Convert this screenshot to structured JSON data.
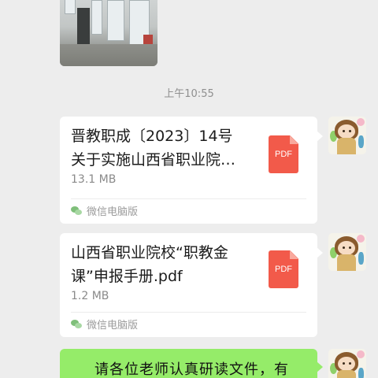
{
  "timestamp": "上午10:55",
  "messages": [
    {
      "type": "file",
      "title_line1": "晋教职成〔2023〕14号",
      "title_line2": "关于实施山西省职业院…",
      "file_size": "13.1 MB",
      "file_icon_label": "PDF",
      "source": "微信电脑版"
    },
    {
      "type": "file",
      "title_line1": "山西省职业院校“职教金",
      "title_line2": "课”申报手册.pdf",
      "file_size": "1.2 MB",
      "file_icon_label": "PDF",
      "source": "微信电脑版"
    },
    {
      "type": "text",
      "text": "请各位老师认真研读文件，有"
    }
  ],
  "colors": {
    "chat_background": "#ededed",
    "bubble_white": "#ffffff",
    "bubble_green": "#95ec69",
    "pdf_icon": "#f25a4a"
  },
  "icons": {
    "file_type": "pdf-file-icon",
    "source": "wechat-icon",
    "avatar": "user-avatar"
  }
}
